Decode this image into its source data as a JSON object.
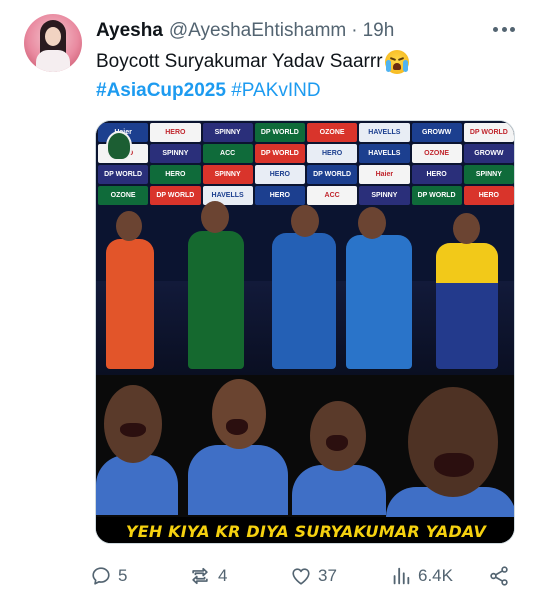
{
  "author": {
    "name": "Ayesha",
    "handle": "@AyeshaEhtishamm",
    "separator": "·",
    "time": "19h"
  },
  "tweet": {
    "text": "Boycott Suryakumar Yadav Saarrr",
    "emoji": "loudly-crying-face",
    "hashtags": [
      "#AsiaCup2025",
      "#PAKvIND"
    ]
  },
  "media": {
    "caption": "YEH KIYA KR DIYA SURYAKUMAR YADAV",
    "sponsor_board": [
      "Haier",
      "HERO",
      "SPINNY",
      "DP WORLD",
      "OZONE",
      "HAVELLS",
      "GROWW",
      "DP WORLD",
      "HERO",
      "SPINNY",
      "ACC",
      "DP WORLD",
      "HERO",
      "HAVELLS",
      "OZONE",
      "GROWW",
      "DP WORLD",
      "HERO",
      "SPINNY",
      "HERO",
      "DP WORLD",
      "Haier",
      "HERO",
      "SPINNY",
      "OZONE",
      "DP WORLD",
      "HAVELLS",
      "HERO",
      "ACC",
      "SPINNY",
      "DP WORLD",
      "HERO"
    ]
  },
  "actions": {
    "replies": "5",
    "reposts": "4",
    "likes": "37",
    "views": "6.4K"
  },
  "colors": {
    "hashtag": "#1d9bf0",
    "muted": "#536471",
    "caption": "#f5d10f"
  }
}
